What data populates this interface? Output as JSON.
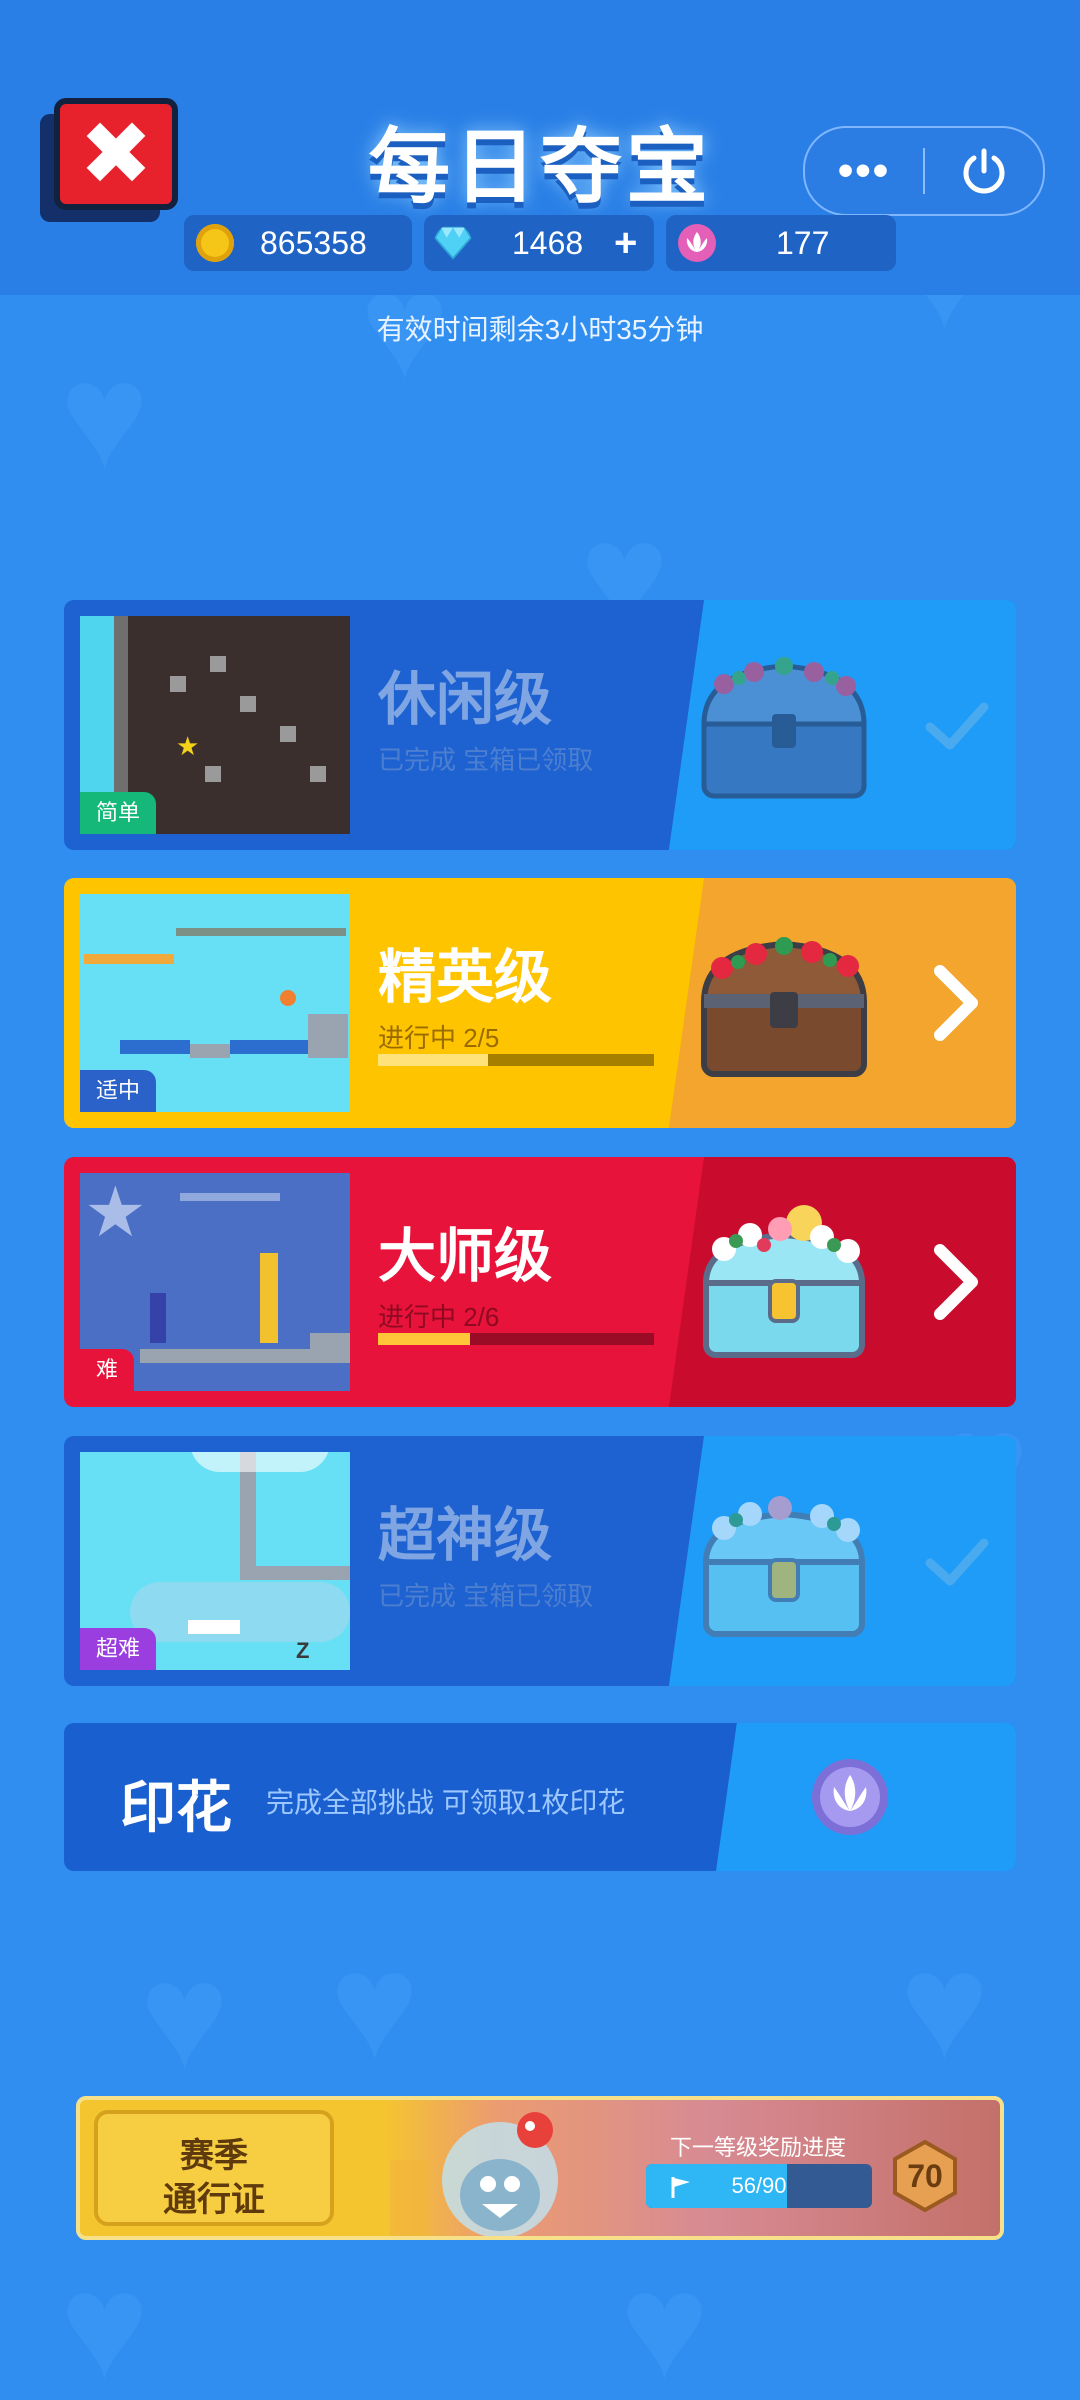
{
  "header": {
    "title": "每日夺宝",
    "more_label": "•••",
    "subtitle": "有效时间剩余3小时35分钟"
  },
  "currencies": {
    "gold": {
      "icon": "gold-coin-icon",
      "value": "865358",
      "color": "#f5c518"
    },
    "diamond": {
      "icon": "diamond-icon",
      "value": "1468",
      "add_label": "+",
      "color": "#4fd0f5"
    },
    "lotus": {
      "icon": "lotus-token-icon",
      "value": "177",
      "color": "#e45fb8"
    }
  },
  "levels": [
    {
      "name": "休闲级",
      "difficulty": "简单",
      "status": "已完成 宝箱已领取",
      "state": "completed",
      "chest": "blue-flower-chest-icon",
      "tag_color": "#16b87a"
    },
    {
      "name": "精英级",
      "difficulty": "适中",
      "status": "进行中 2/5",
      "progress": 0.4,
      "state": "in-progress",
      "chest": "wooden-rose-chest-icon",
      "tag_color": "#2a62c9"
    },
    {
      "name": "大师级",
      "difficulty": "难",
      "status": "进行中 2/6",
      "progress": 0.333,
      "state": "in-progress",
      "chest": "blossom-chest-icon",
      "tag_color": "#e8133a"
    },
    {
      "name": "超神级",
      "difficulty": "超难",
      "status": "已完成 宝箱已领取",
      "state": "completed",
      "chest": "blossom-chest-icon",
      "tag_color": "#9a3ee0"
    }
  ],
  "stamp": {
    "title": "印花",
    "description": "完成全部挑战 可领取1枚印花",
    "icon": "lotus-stamp-icon"
  },
  "season_pass": {
    "badge_line1": "赛季",
    "badge_line2": "通行证",
    "next_label": "下一等级奖励进度",
    "progress_text": "56/90",
    "progress": 0.622,
    "level": "70"
  },
  "colors": {
    "background": "#2f8ef0",
    "header": "#2a7fe6",
    "card_blue": "#1e61d1",
    "card_blue_right": "#1e9cf7",
    "card_yellow": "#ffc400",
    "card_yellow_right": "#f3a52e",
    "card_red": "#e8133a",
    "card_red_right": "#c90c2e"
  }
}
